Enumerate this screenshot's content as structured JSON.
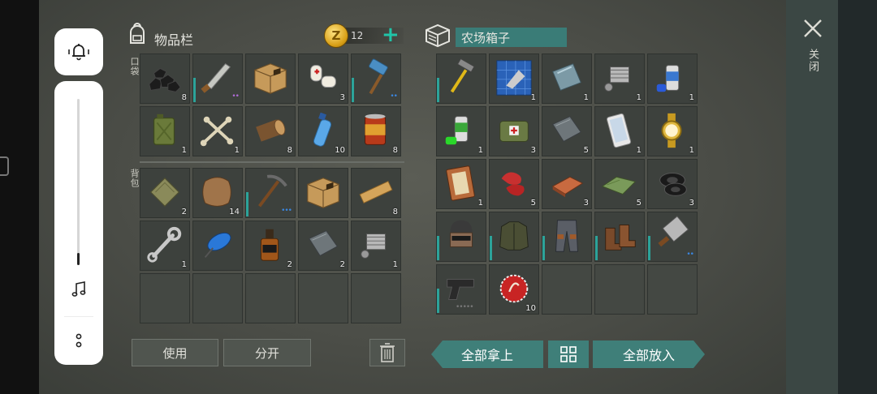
{
  "system_overlay": {
    "bell_icon": "bell-vibrate-icon",
    "volume_level": 0.07,
    "note_icon": "music-note-icon",
    "more_icon": "more-vertical-icon"
  },
  "inventory": {
    "title": "物品栏",
    "coin_value": "12",
    "pocket_label": "口袋",
    "backpack_label": "背包",
    "pocket_slots": [
      {
        "item": "coal",
        "count": "8"
      },
      {
        "item": "machete",
        "count": "",
        "dots": "••",
        "dots_color": "purple",
        "durability": true
      },
      {
        "item": "cardboard-box",
        "count": ""
      },
      {
        "item": "bandage",
        "count": "3"
      },
      {
        "item": "sledgehammer",
        "count": "",
        "dots": "••",
        "durability": true
      },
      {
        "item": "jerrycan",
        "count": "1"
      },
      {
        "item": "bones",
        "count": "1"
      },
      {
        "item": "log",
        "count": "8"
      },
      {
        "item": "water-bottle",
        "count": "10"
      },
      {
        "item": "canned-food",
        "count": "8"
      }
    ],
    "backpack_slots": [
      {
        "item": "cloth",
        "count": "2"
      },
      {
        "item": "leather",
        "count": "14"
      },
      {
        "item": "pickaxe",
        "count": "",
        "dots": "•••",
        "durability": true
      },
      {
        "item": "cardboard-box",
        "count": ""
      },
      {
        "item": "plank",
        "count": "8"
      },
      {
        "item": "wrench",
        "count": "1"
      },
      {
        "item": "blue-blob",
        "count": ""
      },
      {
        "item": "whiskey",
        "count": "2"
      },
      {
        "item": "metal-plate",
        "count": "2"
      },
      {
        "item": "engine-part",
        "count": "1"
      },
      {
        "item": "",
        "count": ""
      },
      {
        "item": "",
        "count": ""
      },
      {
        "item": "",
        "count": ""
      },
      {
        "item": "",
        "count": ""
      },
      {
        "item": "",
        "count": ""
      }
    ],
    "use_button": "使用",
    "split_button": "分开",
    "trash_icon": "trash-icon"
  },
  "farm_box": {
    "title": "农场箱子",
    "slots": [
      {
        "item": "hammer",
        "count": "",
        "durability": true
      },
      {
        "item": "blueprint-cleaver",
        "count": "1"
      },
      {
        "item": "steel-plate",
        "count": "1"
      },
      {
        "item": "engine-part",
        "count": "1"
      },
      {
        "item": "spray-can-blue",
        "count": "1"
      },
      {
        "item": "spray-can-green",
        "count": "1"
      },
      {
        "item": "first-aid-bag",
        "count": "3"
      },
      {
        "item": "metal-plate",
        "count": "5"
      },
      {
        "item": "smartphone",
        "count": "1"
      },
      {
        "item": "gold-watch",
        "count": "1"
      },
      {
        "item": "notebook",
        "count": "1"
      },
      {
        "item": "raw-meat",
        "count": "5"
      },
      {
        "item": "copper-ingot",
        "count": "3"
      },
      {
        "item": "green-cloth",
        "count": "5"
      },
      {
        "item": "tires",
        "count": "3"
      },
      {
        "item": "helmet",
        "count": "",
        "durability": true
      },
      {
        "item": "jacket",
        "count": "",
        "durability": true
      },
      {
        "item": "pants",
        "count": "",
        "durability": true
      },
      {
        "item": "boots",
        "count": "",
        "durability": true
      },
      {
        "item": "cleaver",
        "count": "",
        "dots": "••",
        "durability": true
      },
      {
        "item": "pistol",
        "count": "",
        "dots": "•••••",
        "dots_color": "grey",
        "durability": true
      },
      {
        "item": "bottle-cap",
        "count": "10"
      },
      {
        "item": "",
        "count": ""
      },
      {
        "item": "",
        "count": ""
      },
      {
        "item": "",
        "count": ""
      }
    ],
    "take_all_button": "全部拿上",
    "grid_icon": "grid-icon",
    "put_all_button": "全部放入"
  },
  "close": {
    "label": "关闭",
    "icon": "close-icon"
  },
  "colors": {
    "teal_accent": "#3f7f79",
    "plus_green": "#20c4a8",
    "coin_gold": "#d89f16"
  }
}
